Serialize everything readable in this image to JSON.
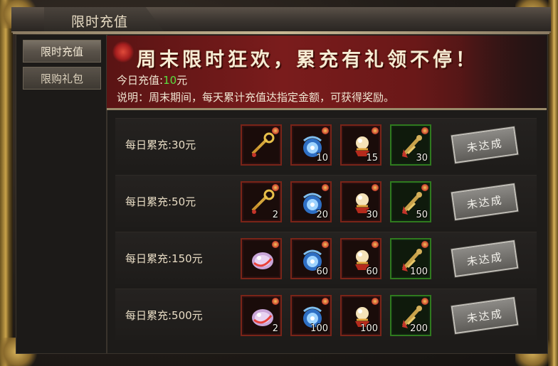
{
  "window": {
    "title": "限时充值"
  },
  "nav": {
    "items": [
      {
        "label": "限时充值",
        "active": true
      },
      {
        "label": "限购礼包",
        "active": false
      }
    ]
  },
  "banner": {
    "headline": "周末限时狂欢，累充有礼领不停！",
    "today_label": "今日充值:",
    "today_amount": "10",
    "today_unit": "元",
    "description": "说明：周末期间，每天累计充值达指定金额，可获得奖励。"
  },
  "rewards": [
    {
      "label": "每日累充:30元",
      "status": "未达成",
      "items": [
        {
          "icon": "golden-key-icon",
          "qty": "",
          "frame": "red"
        },
        {
          "icon": "blue-dragon-orb-icon",
          "qty": "10",
          "frame": "red"
        },
        {
          "icon": "pearl-stand-icon",
          "qty": "15",
          "frame": "red"
        },
        {
          "icon": "red-gold-talisman-icon",
          "qty": "30",
          "frame": "green"
        }
      ]
    },
    {
      "label": "每日累充:50元",
      "status": "未达成",
      "items": [
        {
          "icon": "golden-key-icon",
          "qty": "2",
          "frame": "red"
        },
        {
          "icon": "blue-dragon-orb-icon",
          "qty": "20",
          "frame": "red"
        },
        {
          "icon": "pearl-stand-icon",
          "qty": "30",
          "frame": "red"
        },
        {
          "icon": "red-gold-talisman-icon",
          "qty": "50",
          "frame": "green"
        }
      ]
    },
    {
      "label": "每日累充:150元",
      "status": "未达成",
      "items": [
        {
          "icon": "crystal-gem-icon",
          "qty": "",
          "frame": "red"
        },
        {
          "icon": "blue-dragon-orb-icon",
          "qty": "60",
          "frame": "red"
        },
        {
          "icon": "pearl-stand-icon",
          "qty": "60",
          "frame": "red"
        },
        {
          "icon": "red-gold-talisman-icon",
          "qty": "100",
          "frame": "green"
        }
      ]
    },
    {
      "label": "每日累充:500元",
      "status": "未达成",
      "items": [
        {
          "icon": "crystal-gem-icon",
          "qty": "2",
          "frame": "red"
        },
        {
          "icon": "blue-dragon-orb-icon",
          "qty": "100",
          "frame": "red"
        },
        {
          "icon": "pearl-stand-icon",
          "qty": "100",
          "frame": "red"
        },
        {
          "icon": "red-gold-talisman-icon",
          "qty": "200",
          "frame": "green"
        }
      ]
    }
  ],
  "colors": {
    "accent_green": "#58e040",
    "banner_red": "#7a1c1c",
    "frame_gold": "#c9a24a"
  }
}
